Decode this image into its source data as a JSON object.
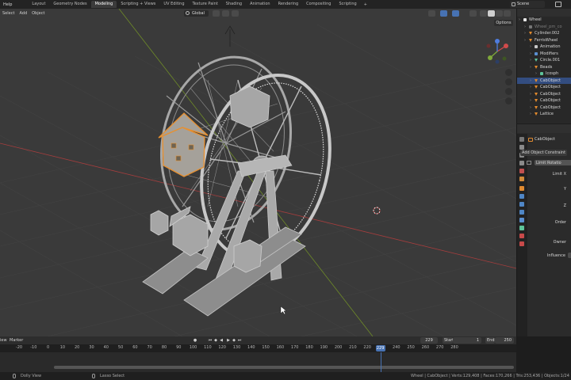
{
  "menu": {
    "help": "Help"
  },
  "workspace_tabs": [
    {
      "label": "Layout",
      "active": false
    },
    {
      "label": "Geometry Nodes",
      "active": false
    },
    {
      "label": "Modeling",
      "active": true
    },
    {
      "label": "Scripting + Views",
      "active": false
    },
    {
      "label": "UV Editing",
      "active": false
    },
    {
      "label": "Texture Paint",
      "active": false
    },
    {
      "label": "Shading",
      "active": false
    },
    {
      "label": "Animation",
      "active": false
    },
    {
      "label": "Rendering",
      "active": false
    },
    {
      "label": "Compositing",
      "active": false
    },
    {
      "label": "Scripting",
      "active": false
    }
  ],
  "add_tab": "+",
  "scene": {
    "label": "Scene"
  },
  "viewport": {
    "menus": [
      "Select",
      "Add",
      "Object"
    ],
    "orientation": "Global",
    "options": "Options"
  },
  "outliner": {
    "rows": [
      {
        "label": "Wheel",
        "indent": 0,
        "icon": "collection",
        "selected": false
      },
      {
        "label": "Wheel_pm_co",
        "indent": 1,
        "icon": "dim",
        "selected": false
      },
      {
        "label": "Cylinder.002",
        "indent": 1,
        "icon": "mesh",
        "selected": false
      },
      {
        "label": "FerrisWheel",
        "indent": 1,
        "icon": "mesh",
        "selected": false
      },
      {
        "label": "Animation",
        "indent": 2,
        "icon": "anim",
        "selected": false
      },
      {
        "label": "Modifiers",
        "indent": 2,
        "icon": "wrench",
        "selected": false
      },
      {
        "label": "Circle.001",
        "indent": 2,
        "icon": "curve",
        "selected": false
      },
      {
        "label": "Beads",
        "indent": 2,
        "icon": "mesh",
        "selected": false
      },
      {
        "label": "Icosph",
        "indent": 3,
        "icon": "data",
        "selected": false
      },
      {
        "label": "CabObject",
        "indent": 2,
        "icon": "mesh",
        "selected": true
      },
      {
        "label": "CabObject",
        "indent": 2,
        "icon": "mesh",
        "selected": false
      },
      {
        "label": "CabObject",
        "indent": 2,
        "icon": "mesh",
        "selected": false
      },
      {
        "label": "CabObject",
        "indent": 2,
        "icon": "mesh",
        "selected": false
      },
      {
        "label": "CabObject",
        "indent": 2,
        "icon": "mesh",
        "selected": false
      },
      {
        "label": "Lattice",
        "indent": 2,
        "icon": "mesh",
        "selected": false
      }
    ]
  },
  "properties": {
    "object_name": "CabObject",
    "add_constraint": "Add Object Constraint",
    "constraint_name": "Limit Rotatio",
    "fields": [
      "Limit X",
      "Y",
      "Z",
      "Order",
      "Owner",
      "Influence"
    ]
  },
  "timeline": {
    "menus": [
      "iew",
      "Marker"
    ],
    "current_frame": "229",
    "start_label": "Start",
    "start_value": "1",
    "end_label": "End",
    "end_value": "250",
    "ruler": [
      "-20",
      "-10",
      "0",
      "10",
      "20",
      "30",
      "40",
      "50",
      "60",
      "70",
      "80",
      "90",
      "100",
      "110",
      "120",
      "130",
      "140",
      "150",
      "160",
      "170",
      "180",
      "190",
      "200",
      "210",
      "220",
      "230",
      "240",
      "250",
      "260",
      "270",
      "280"
    ],
    "playhead": "229"
  },
  "status": {
    "left": "Dolly View",
    "mid": "Lasso Select",
    "right": "Wheel | CabObject | Verts:129,408 | Faces:170,266 | Tris:253,436 | Objects:1/24 | Memory"
  },
  "colors": {
    "accent": "#4772b3",
    "selection_outline": "#e8902f",
    "viewport_bg": "#3a3a3a",
    "x_axis": "#a53d3d",
    "y_axis": "#7a9b2a"
  }
}
